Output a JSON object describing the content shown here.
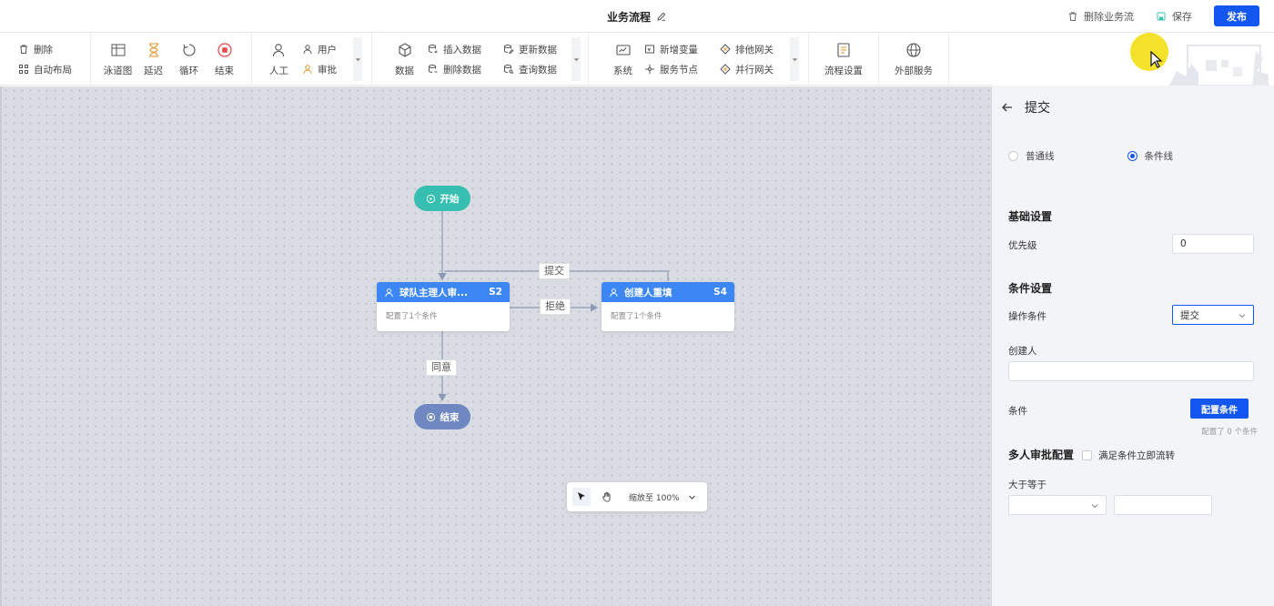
{
  "header": {
    "title": "业务流程",
    "delete_flow": "删除业务流",
    "save": "保存",
    "publish": "发布"
  },
  "toolbar": {
    "edit": {
      "delete": "删除",
      "auto_layout": "自动布局"
    },
    "basic": [
      "泳道图",
      "延迟",
      "循环",
      "结束"
    ],
    "human": {
      "main": "人工",
      "user": "用户",
      "approve": "审批"
    },
    "data": {
      "main": "数据",
      "insert": "插入数据",
      "update": "更新数据",
      "delete": "删除数据",
      "query": "查询数据"
    },
    "system": {
      "main": "系统",
      "new_var": "新增变量",
      "exclusive_gw": "排他网关",
      "service_node": "服务节点",
      "parallel_gw": "并行网关"
    },
    "flow_settings": "流程设置",
    "external": "外部服务"
  },
  "canvas": {
    "nodes": {
      "start": "开始",
      "end": "结束",
      "s2": {
        "title": "球队主理人审...",
        "code": "S2",
        "desc": "配置了1个条件"
      },
      "s4": {
        "title": "创建人重填",
        "code": "S4",
        "desc": "配置了1个条件"
      }
    },
    "edges": {
      "submit": "提交",
      "reject": "拒绝",
      "agree": "同意"
    },
    "zoom": "缩放至 100%"
  },
  "panel": {
    "title": "提交",
    "line_type": {
      "normal": "普通线",
      "conditional": "条件线",
      "selected": "conditional"
    },
    "basic": "基础设置",
    "priority_label": "优先级",
    "priority_value": "0",
    "condition_settings": "条件设置",
    "op_condition_label": "操作条件",
    "op_condition_value": "提交",
    "creator_label": "创建人",
    "creator_value": "",
    "condition_label": "条件",
    "config_button": "配置条件",
    "config_hint": "配置了 0 个条件",
    "multi_approval": "多人审批配置",
    "multi_checkbox": "满足条件立即流转",
    "gte_label": "大于等于",
    "gte_select": "",
    "gte_input": ""
  },
  "colors": {
    "primary": "#1456f0",
    "start": "#36bfb1",
    "end": "#7088c2",
    "node_head": "#3d86f5"
  }
}
